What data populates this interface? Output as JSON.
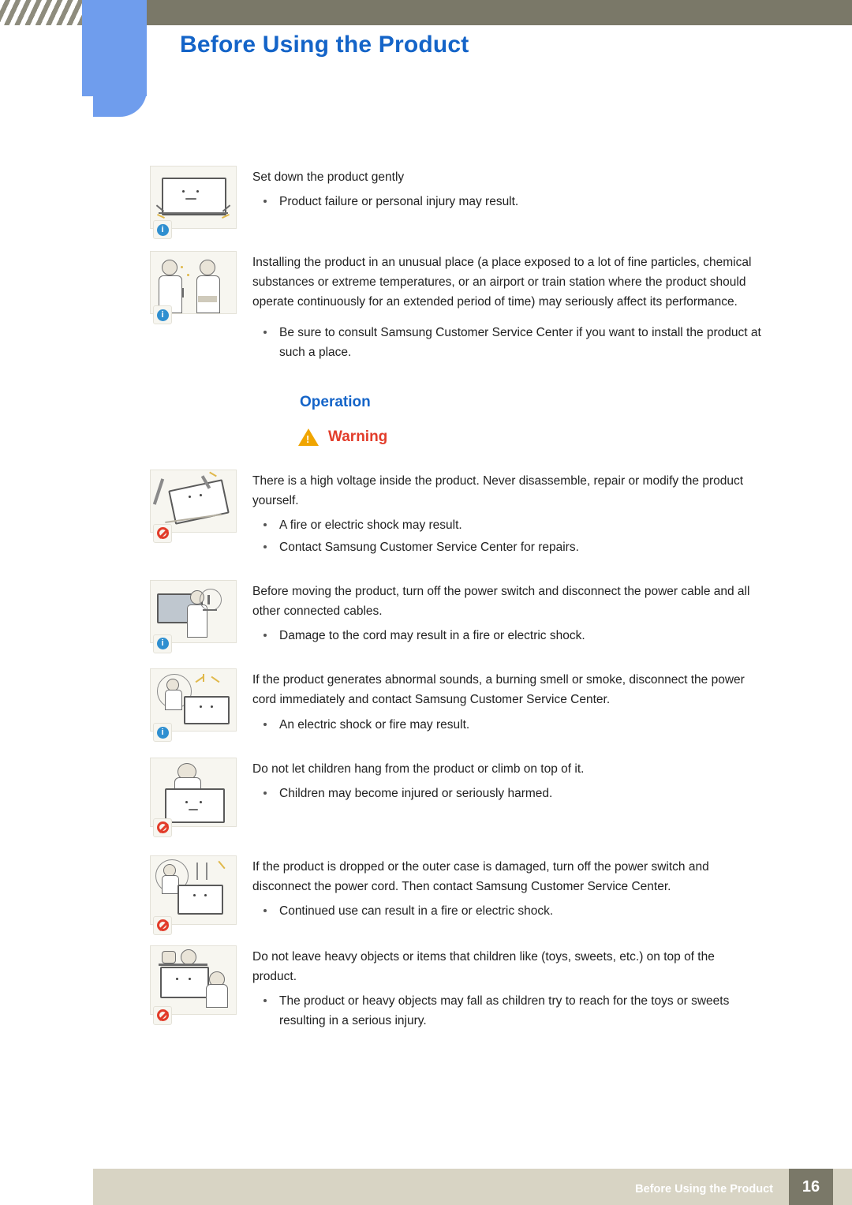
{
  "header": {
    "title": "Before Using the Product"
  },
  "footer": {
    "text": "Before Using the Product",
    "page": "16"
  },
  "section": {
    "heading": "Operation",
    "warning_label": "Warning",
    "warning_icon": "warning-triangle-icon"
  },
  "blocks": [
    {
      "icon": "tv-set-down-gently-icon",
      "badge": "info-icon",
      "paragraphs": [
        "Set down the product gently"
      ],
      "bullets": [
        "Product failure or personal injury may result."
      ]
    },
    {
      "icon": "unusual-place-installation-icon",
      "badge": "info-icon",
      "paragraphs": [
        "Installing the product in an unusual place (a place exposed to a lot of fine particles, chemical substances or extreme temperatures, or an airport or train station where the product should operate continuously for an extended period of time) may seriously affect its performance."
      ],
      "bullets": [
        "Be sure to consult Samsung Customer Service Center if you want to install the product at such a place."
      ]
    },
    {
      "icon": "do-not-disassemble-icon",
      "badge": "prohibited-icon",
      "paragraphs": [
        "There is a high voltage inside the product. Never disassemble, repair or modify the product yourself."
      ],
      "bullets": [
        "A fire or electric shock may result.",
        "Contact Samsung Customer Service Center for repairs."
      ]
    },
    {
      "icon": "unplug-before-moving-icon",
      "badge": "info-icon",
      "paragraphs": [
        "Before moving the product, turn off the power switch and disconnect the power cable and all other connected cables."
      ],
      "bullets": [
        "Damage to the cord may result in a fire or electric shock."
      ]
    },
    {
      "icon": "abnormal-sounds-smoke-icon",
      "badge": "info-icon",
      "paragraphs": [
        "If the product generates abnormal sounds, a burning smell or smoke, disconnect the power cord immediately and contact Samsung Customer Service Center."
      ],
      "bullets": [
        "An electric shock or fire may result."
      ]
    },
    {
      "icon": "no-children-hanging-icon",
      "badge": "prohibited-icon",
      "paragraphs": [
        "Do not let children hang from the product or climb on top of it."
      ],
      "bullets": [
        "Children may become injured or seriously harmed."
      ]
    },
    {
      "icon": "dropped-product-damage-icon",
      "badge": "prohibited-icon",
      "paragraphs": [
        "If the product is dropped or the outer case is damaged, turn off the power switch and disconnect the power cord. Then contact Samsung Customer Service Center."
      ],
      "bullets": [
        "Continued use can result in a fire or electric shock."
      ]
    },
    {
      "icon": "no-heavy-objects-on-top-icon",
      "badge": "prohibited-icon",
      "paragraphs": [
        "Do not leave heavy objects or items that children like (toys, sweets, etc.) on top of the product."
      ],
      "bullets": [
        "The product or heavy objects may fall as children try to reach for the toys or sweets resulting in a serious injury."
      ]
    }
  ]
}
